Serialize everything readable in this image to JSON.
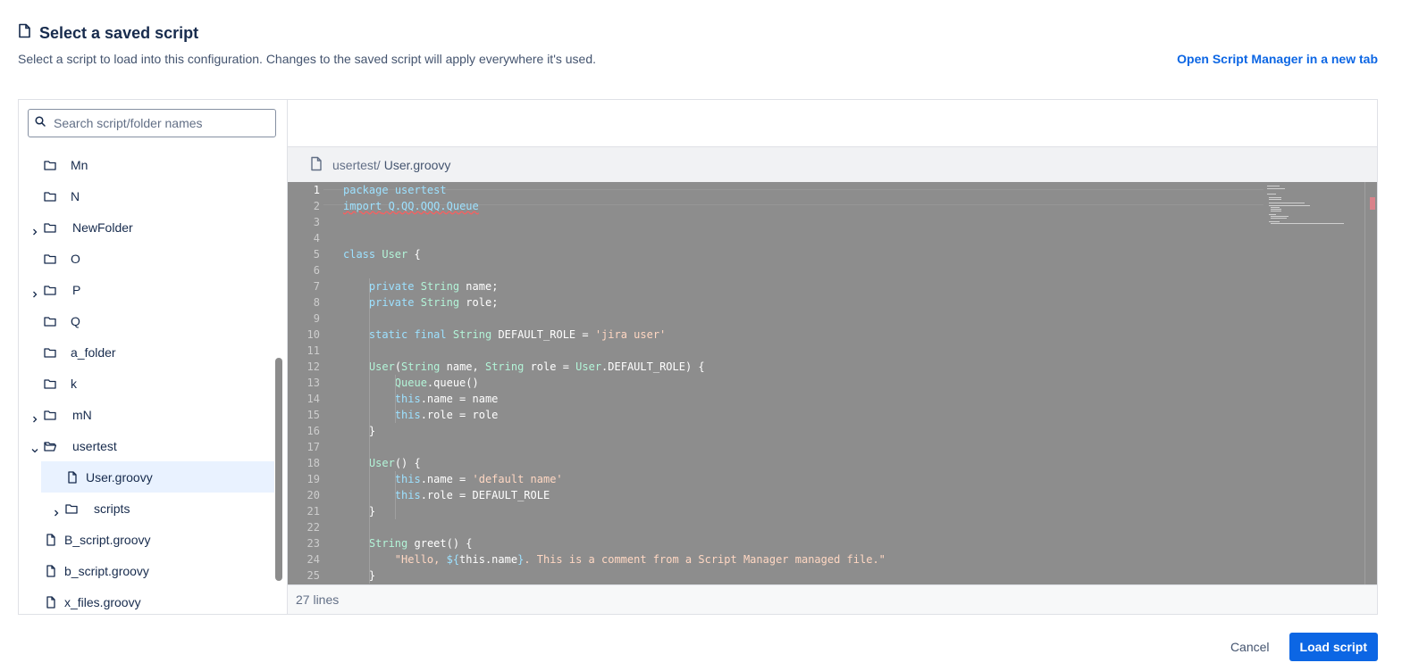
{
  "header": {
    "title": "Select a saved script",
    "subtitle": "Select a script to load into this configuration. Changes to the saved script will apply everywhere it's used.",
    "open_link": "Open Script Manager in a new tab"
  },
  "search": {
    "placeholder": "Search script/folder names"
  },
  "tree": {
    "items": [
      {
        "label": "Mn",
        "type": "folder",
        "depth": 0,
        "expandable": false
      },
      {
        "label": "N",
        "type": "folder",
        "depth": 0,
        "expandable": false
      },
      {
        "label": "NewFolder",
        "type": "folder",
        "depth": 0,
        "expandable": true
      },
      {
        "label": "O",
        "type": "folder",
        "depth": 0,
        "expandable": false
      },
      {
        "label": "P",
        "type": "folder",
        "depth": 0,
        "expandable": true
      },
      {
        "label": "Q",
        "type": "folder",
        "depth": 0,
        "expandable": false
      },
      {
        "label": "a_folder",
        "type": "folder",
        "depth": 0,
        "expandable": false
      },
      {
        "label": "k",
        "type": "folder",
        "depth": 0,
        "expandable": false
      },
      {
        "label": "mN",
        "type": "folder",
        "depth": 0,
        "expandable": true
      },
      {
        "label": "usertest",
        "type": "folder-open",
        "depth": 0,
        "expandable": true,
        "expanded": true
      },
      {
        "label": "User.groovy",
        "type": "file",
        "depth": 1,
        "selected": true
      },
      {
        "label": "scripts",
        "type": "folder",
        "depth": 1,
        "expandable": true
      },
      {
        "label": "B_script.groovy",
        "type": "file",
        "depth": 0
      },
      {
        "label": "b_script.groovy",
        "type": "file",
        "depth": 0
      },
      {
        "label": "x_files.groovy",
        "type": "file",
        "depth": 0
      }
    ]
  },
  "file": {
    "path": "usertest/",
    "name": "User.groovy"
  },
  "editor": {
    "lines": [
      [
        [
          "kw",
          "package"
        ],
        [
          "t",
          " "
        ],
        [
          "kw",
          "usertest"
        ]
      ],
      [
        [
          "kw ul",
          "import"
        ],
        [
          "ul",
          " "
        ],
        [
          "kw ul",
          "Q.QQ.QQQ.Queue"
        ]
      ],
      [],
      [],
      [
        [
          "kw",
          "class"
        ],
        [
          "t",
          " "
        ],
        [
          "cls",
          "User"
        ],
        [
          "t",
          " {"
        ]
      ],
      [],
      [
        [
          "t",
          "    "
        ],
        [
          "kw",
          "private"
        ],
        [
          "t",
          " "
        ],
        [
          "ty",
          "String"
        ],
        [
          "t",
          " name;"
        ]
      ],
      [
        [
          "t",
          "    "
        ],
        [
          "kw",
          "private"
        ],
        [
          "t",
          " "
        ],
        [
          "ty",
          "String"
        ],
        [
          "t",
          " role;"
        ]
      ],
      [],
      [
        [
          "t",
          "    "
        ],
        [
          "kw",
          "static"
        ],
        [
          "t",
          " "
        ],
        [
          "kw",
          "final"
        ],
        [
          "t",
          " "
        ],
        [
          "ty",
          "String"
        ],
        [
          "t",
          " DEFAULT_ROLE = "
        ],
        [
          "str",
          "'jira user'"
        ]
      ],
      [],
      [
        [
          "t",
          "    "
        ],
        [
          "cls",
          "User"
        ],
        [
          "t",
          "("
        ],
        [
          "ty",
          "String"
        ],
        [
          "t",
          " name, "
        ],
        [
          "ty",
          "String"
        ],
        [
          "t",
          " role = "
        ],
        [
          "cls",
          "User"
        ],
        [
          "t",
          ".DEFAULT_ROLE) {"
        ]
      ],
      [
        [
          "t",
          "        "
        ],
        [
          "cls",
          "Queue"
        ],
        [
          "t",
          ".queue()"
        ]
      ],
      [
        [
          "t",
          "        "
        ],
        [
          "kw",
          "this"
        ],
        [
          "t",
          ".name = name"
        ]
      ],
      [
        [
          "t",
          "        "
        ],
        [
          "kw",
          "this"
        ],
        [
          "t",
          ".role = role"
        ]
      ],
      [
        [
          "t",
          "    }"
        ]
      ],
      [],
      [
        [
          "t",
          "    "
        ],
        [
          "cls",
          "User"
        ],
        [
          "t",
          "() {"
        ]
      ],
      [
        [
          "t",
          "        "
        ],
        [
          "kw",
          "this"
        ],
        [
          "t",
          ".name = "
        ],
        [
          "str",
          "'default name'"
        ]
      ],
      [
        [
          "t",
          "        "
        ],
        [
          "kw",
          "this"
        ],
        [
          "t",
          ".role = DEFAULT_ROLE"
        ]
      ],
      [
        [
          "t",
          "    }"
        ]
      ],
      [],
      [
        [
          "t",
          "    "
        ],
        [
          "ty",
          "String"
        ],
        [
          "t",
          " greet() {"
        ]
      ],
      [
        [
          "t",
          "        "
        ],
        [
          "str",
          "\"Hello, "
        ],
        [
          "kw",
          "${"
        ],
        [
          "t",
          "this.name"
        ],
        [
          "kw",
          "}"
        ],
        [
          "str",
          ". This is a comment from a Script Manager managed file.\""
        ]
      ],
      [
        [
          "t",
          "    }"
        ]
      ]
    ],
    "line_count_label": "27 lines"
  },
  "actions": {
    "cancel": "Cancel",
    "load": "Load script"
  },
  "colors": {
    "accent": "#0c66e4",
    "selected_bg": "#e9f2ff",
    "editor_overlay": "#8d8d8d"
  }
}
